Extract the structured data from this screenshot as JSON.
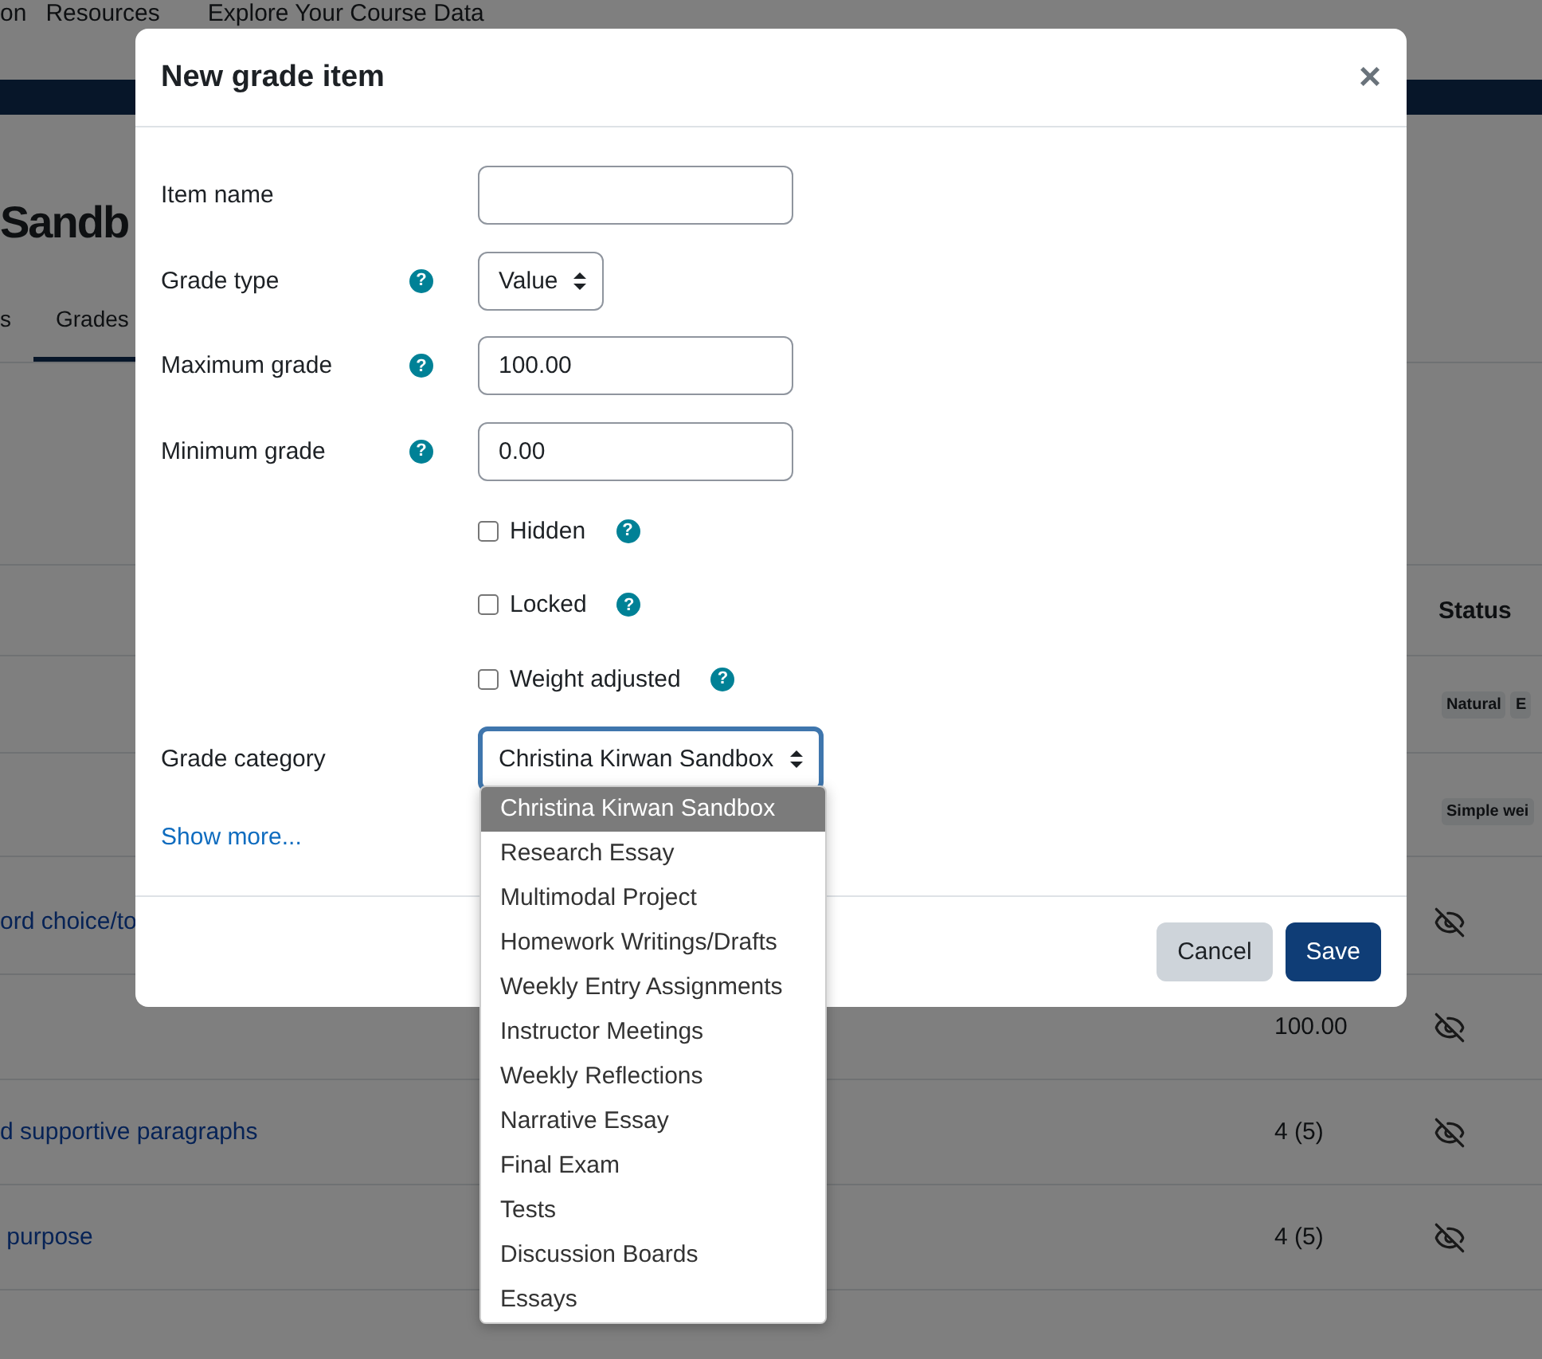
{
  "nav": {
    "items": [
      "on",
      "Resources",
      "Explore Your Course Data"
    ]
  },
  "page_title": "Sandb",
  "tabs": [
    {
      "label": "s",
      "selected": false
    },
    {
      "label": "Grades",
      "selected": true
    }
  ],
  "table": {
    "status_header": "Status",
    "category_rows": [
      {
        "badges": [
          "Natural",
          "E"
        ]
      },
      {
        "badges": [
          "Simple wei"
        ]
      }
    ],
    "rows": [
      {
        "name": "ord choice/to",
        "value": "",
        "hidden": true
      },
      {
        "name": "",
        "value": "100.00",
        "hidden": true
      },
      {
        "name": "d supportive paragraphs",
        "value": "4 (5)",
        "hidden": true
      },
      {
        "name": " purpose",
        "value": "4 (5)",
        "hidden": true
      }
    ]
  },
  "modal": {
    "title": "New grade item",
    "close": "×",
    "fields": [
      {
        "kind": "text",
        "label": "Item name"
      },
      {
        "kind": "select",
        "label": "Grade type",
        "help": "?",
        "value": "Value"
      },
      {
        "kind": "text",
        "label": "Maximum grade",
        "help": "?",
        "value": "100.00"
      },
      {
        "kind": "text",
        "label": "Minimum grade",
        "help": "?",
        "value": "0.00"
      },
      {
        "kind": "checkbox",
        "label": "Hidden",
        "help": "?",
        "checked": false
      },
      {
        "kind": "checkbox",
        "label": "Locked",
        "help": "?",
        "checked": false
      },
      {
        "kind": "checkbox",
        "label": "Weight adjusted",
        "help": "?",
        "checked": false
      },
      {
        "kind": "select",
        "label": "Grade category",
        "value": "Christina Kirwan Sandbox",
        "expanded": true,
        "options": [
          {
            "label": "Christina Kirwan Sandbox",
            "selected": true
          },
          {
            "label": "Research Essay",
            "selected": false
          },
          {
            "label": "Multimodal Project",
            "selected": false
          },
          {
            "label": "Homework Writings/Drafts",
            "selected": false
          },
          {
            "label": "Weekly Entry Assignments",
            "selected": false
          },
          {
            "label": "Instructor Meetings",
            "selected": false
          },
          {
            "label": "Weekly Reflections",
            "selected": false
          },
          {
            "label": "Narrative Essay",
            "selected": false
          },
          {
            "label": "Final Exam",
            "selected": false
          },
          {
            "label": "Tests",
            "selected": false
          },
          {
            "label": "Discussion Boards",
            "selected": false
          },
          {
            "label": "Essays",
            "selected": false
          }
        ]
      }
    ],
    "show_more": "Show more...",
    "buttons": [
      {
        "label": "Cancel",
        "kind": "secondary"
      },
      {
        "label": "Save",
        "kind": "primary"
      }
    ]
  }
}
